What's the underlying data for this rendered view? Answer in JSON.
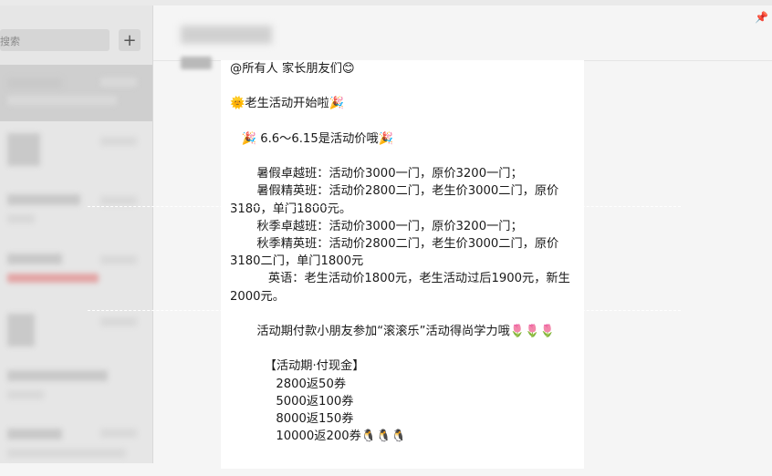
{
  "sidebar": {
    "search_placeholder": "搜索",
    "add_label": "+"
  },
  "chat": {
    "pin_glyph": "📌",
    "message_lines": [
      "@所有人 家长朋友们😊",
      "",
      "🌞老生活动开始啦🎉",
      "",
      "   🎉 6.6～6.15是活动价哦🎉",
      "",
      "       暑假卓越班：活动价3000一门，原价3200一门；",
      "       暑假精英班：活动价2800二门，老生价3000二门，原价3180，单门1800元。",
      "       秋季卓越班：活动价3000一门，原价3200一门；",
      "       秋季精英班：活动价2800二门，老生价3000二门，原价3180二门，单门1800元",
      "          英语：老生活动价1800元，老生活动过后1900元，新生2000元。",
      "",
      "       活动期付款小朋友参加“滚滚乐”活动得尚学力哦🌷🌷🌷",
      "",
      "         【活动期·付现金】",
      "            2800返50券",
      "            5000返100券",
      "            8000返150券",
      "            10000返200券🐧🐧🐧"
    ]
  }
}
